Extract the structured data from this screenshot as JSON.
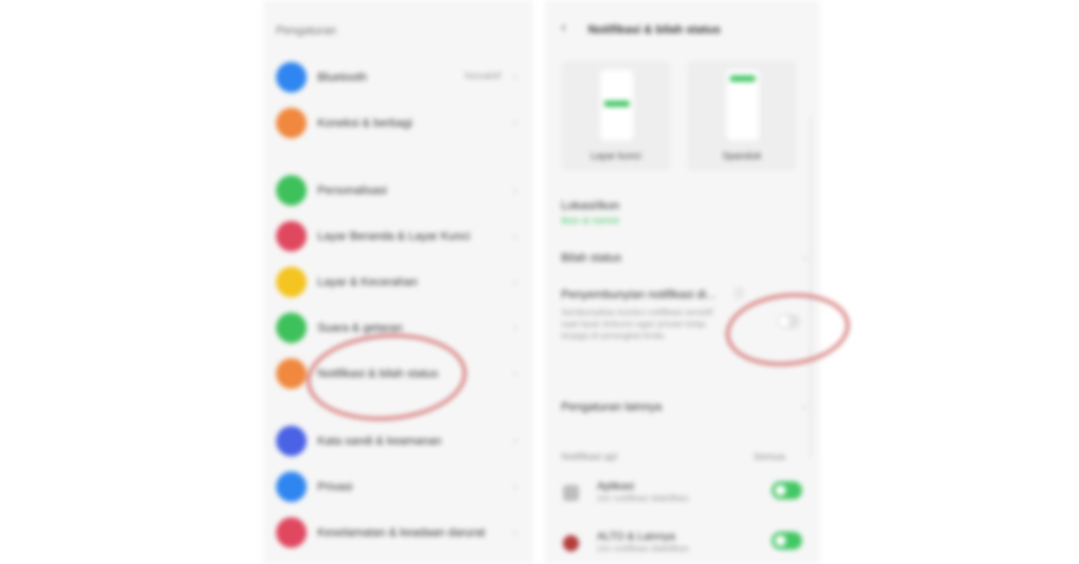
{
  "colors": {
    "accent_green": "#43c765",
    "highlight_ring": "#d77a7a",
    "icon_blue": "#2f86f0",
    "icon_orange": "#f0883e",
    "icon_green": "#3ec15a",
    "icon_red": "#e04860",
    "icon_yellow": "#f4c420",
    "icon_indigo": "#4a62e6"
  },
  "left": {
    "section_title": "Pengaturan",
    "items": [
      {
        "label": "Bluetooth",
        "value": "Nonaktif",
        "icon": "bluetooth-icon",
        "color": "#2f86f0"
      },
      {
        "label": "Koneksi & berbagi",
        "value": "",
        "icon": "share-icon",
        "color": "#f0883e"
      },
      {
        "label": "Personalisasi",
        "value": "",
        "icon": "palette-icon",
        "color": "#3ec15a"
      },
      {
        "label": "Layar Beranda & Layar Kunci",
        "value": "",
        "icon": "home-screen-icon",
        "color": "#e04860"
      },
      {
        "label": "Layar & Kecerahan",
        "value": "",
        "icon": "brightness-icon",
        "color": "#f4c420"
      },
      {
        "label": "Suara & getaran",
        "value": "",
        "icon": "sound-icon",
        "color": "#3ec15a"
      },
      {
        "label": "Notifikasi & bilah status",
        "value": "",
        "icon": "notification-icon",
        "color": "#f0883e"
      },
      {
        "label": "Kata sandi & keamanan",
        "value": "",
        "icon": "lock-icon",
        "color": "#4a62e6"
      },
      {
        "label": "Privasi",
        "value": "",
        "icon": "privacy-icon",
        "color": "#2f86f0"
      },
      {
        "label": "Keselamatan & keadaan darurat",
        "value": "",
        "icon": "emergency-icon",
        "color": "#e04860"
      }
    ]
  },
  "right": {
    "back_label": "‹",
    "title": "Notifikasi & bilah status",
    "styles": [
      {
        "label": "Layar kunci"
      },
      {
        "label": "Spanduk"
      }
    ],
    "lock_screen": {
      "label": "Lokasi/ikon",
      "value": "Ikon & nomor"
    },
    "bilah_status": "Bilah status",
    "privacy_label": "Penyembunyian notifikasi di...",
    "privacy_desc": "Sembunyikan konten notifikasi sensitif saat layar terkunci agar privasi tetap terjaga di perangkat Anda.",
    "pengaturan_lainnya": "Pengaturan lainnya",
    "apps_header": "Notifikasi apl",
    "apps_action": "Semua",
    "apps": [
      {
        "name": "Aplikasi",
        "sub": "Izin notifikasi diaktifkan",
        "icon_color": "#bdbdbd",
        "enabled": true
      },
      {
        "name": "ALTO & Lainnya",
        "sub": "Izin notifikasi diaktifkan",
        "icon_color": "#b43c3c",
        "enabled": true
      }
    ]
  }
}
